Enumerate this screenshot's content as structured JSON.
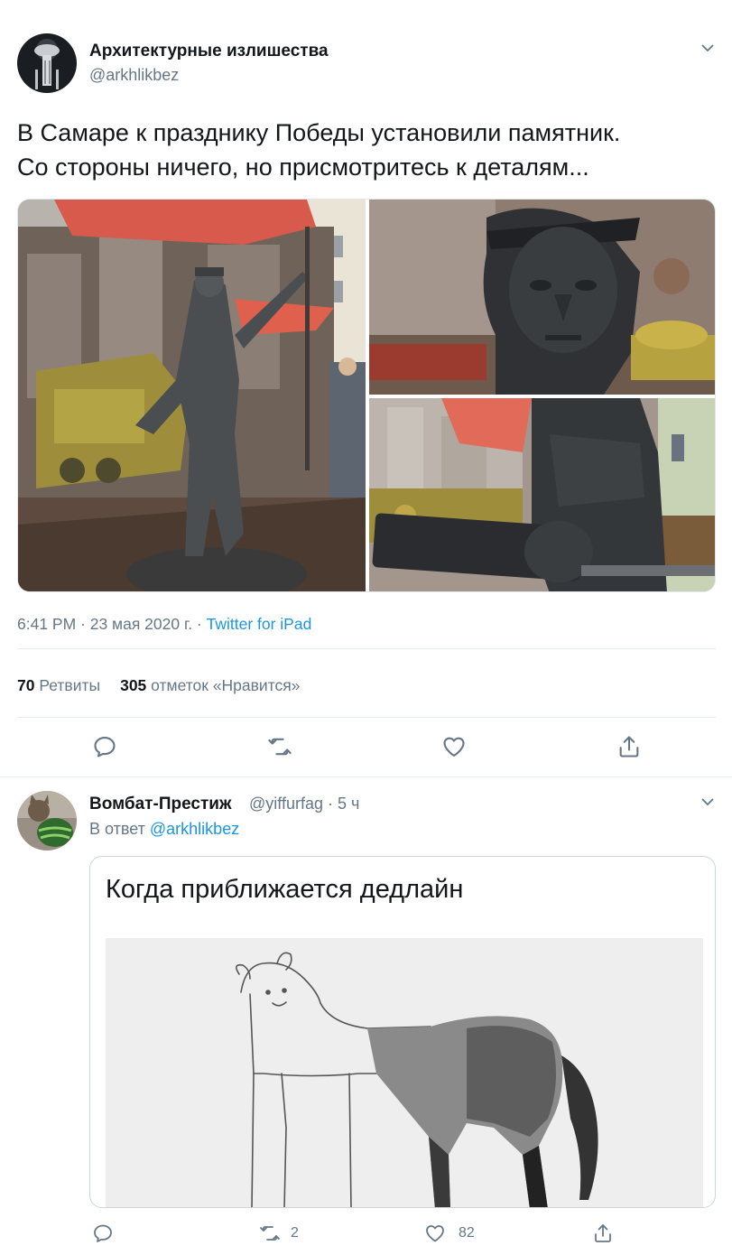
{
  "tweet": {
    "author_name": "Архитектурные излишества",
    "author_handle": "@arkhlikbez",
    "text_line1": "В Самаре к празднику Победы установили памятник.",
    "text_line2": "Со стороны ничего, но присмотритесь к деталям...",
    "timestamp": "6:41 PM · 23 мая 2020 г. · ",
    "source": "Twitter for iPad",
    "retweets_count": "70",
    "retweets_label": "Ретвиты",
    "likes_count": "305",
    "likes_label": "отметок «Нравится»"
  },
  "reply": {
    "author_name": "Вомбат-Престиж",
    "author_handle": "@yiffurfag",
    "time": " · 5 ч",
    "reply_prefix": "В ответ ",
    "reply_mention": "@arkhlikbez",
    "meme_title": "Когда приближается дедлайн",
    "retweets_count": "2",
    "likes_count": "82"
  },
  "icons": {
    "reply": "reply-icon",
    "retweet": "retweet-icon",
    "like": "heart-icon",
    "share": "share-icon",
    "menu": "chevron-down-icon"
  },
  "colors": {
    "accent": "#1b95e0",
    "muted": "#657786",
    "text": "#14171a",
    "divider": "#e6ecf0"
  }
}
